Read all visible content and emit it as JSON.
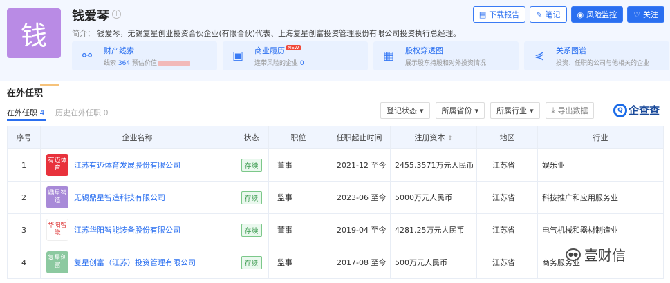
{
  "profile": {
    "avatar_char": "钱",
    "name": "钱爱琴",
    "intro_label": "简介：",
    "intro_text": "钱爱琴，无锡复星创业投资合伙企业(有限合伙)代表、上海复星创富投资管理股份有限公司投资执行总经理。"
  },
  "actions": [
    {
      "label": "下载报告",
      "icon": "document-icon"
    },
    {
      "label": "笔记",
      "icon": "edit-icon"
    },
    {
      "label": "风险监控",
      "icon": "monitor-icon"
    },
    {
      "label": "关注",
      "icon": "heart-icon"
    }
  ],
  "cards": [
    {
      "title": "财产线索",
      "sub_label": "线索",
      "sub_value": "364",
      "sub_extra": "预估价值",
      "icon": "link-icon"
    },
    {
      "title": "商业履历",
      "badge": "NEW",
      "sub_label": "连带风险的企业",
      "sub_value": "0",
      "icon": "briefcase-icon"
    },
    {
      "title": "股权穿透图",
      "sub_label": "展示股东持股和对外投资情况",
      "icon": "org-chart-icon"
    },
    {
      "title": "关系图谱",
      "sub_label": "投资、任职的公司与他相关的企业",
      "icon": "share-icon"
    }
  ],
  "section": {
    "title": "在外任职",
    "tab_active": "在外任职",
    "tab_active_count": "4",
    "tab_hist": "历史在外任职",
    "tab_hist_count": "0"
  },
  "filters": [
    "登记状态",
    "所属省份",
    "所属行业"
  ],
  "export_label": "导出数据",
  "brand": "企查查",
  "table": {
    "headers": [
      "序号",
      "企业名称",
      "状态",
      "职位",
      "任职起止时间",
      "注册资本",
      "地区",
      "行业"
    ],
    "rows": [
      {
        "num": "1",
        "logo": "有迈体育",
        "logo_color": "#e8323c",
        "name": "江苏有迈体育发展股份有限公司",
        "status": "存续",
        "position": "董事",
        "period": "2021-12 至今",
        "capital": "2455.3571万元人民币",
        "area": "江苏省",
        "industry": "娱乐业"
      },
      {
        "num": "2",
        "logo": "鼎星智造",
        "logo_color": "#a88ad8",
        "name": "无锡鼎星智造科技有限公司",
        "status": "存续",
        "position": "监事",
        "period": "2023-06 至今",
        "capital": "5000万元人民币",
        "area": "江苏省",
        "industry": "科技推广和应用服务业"
      },
      {
        "num": "3",
        "logo": "华阳智能",
        "logo_color": "#ffffff",
        "name": "江苏华阳智能装备股份有限公司",
        "status": "存续",
        "position": "董事",
        "period": "2019-04 至今",
        "capital": "4281.25万元人民币",
        "area": "江苏省",
        "industry": "电气机械和器材制造业"
      },
      {
        "num": "4",
        "logo": "复星创富",
        "logo_color": "#8cc9a0",
        "name": "复星创富（江苏）投资管理有限公司",
        "status": "存续",
        "position": "监事",
        "period": "2017-08 至今",
        "capital": "500万元人民币",
        "area": "江苏省",
        "industry": "商务服务业"
      }
    ]
  },
  "watermark": "壹财信"
}
